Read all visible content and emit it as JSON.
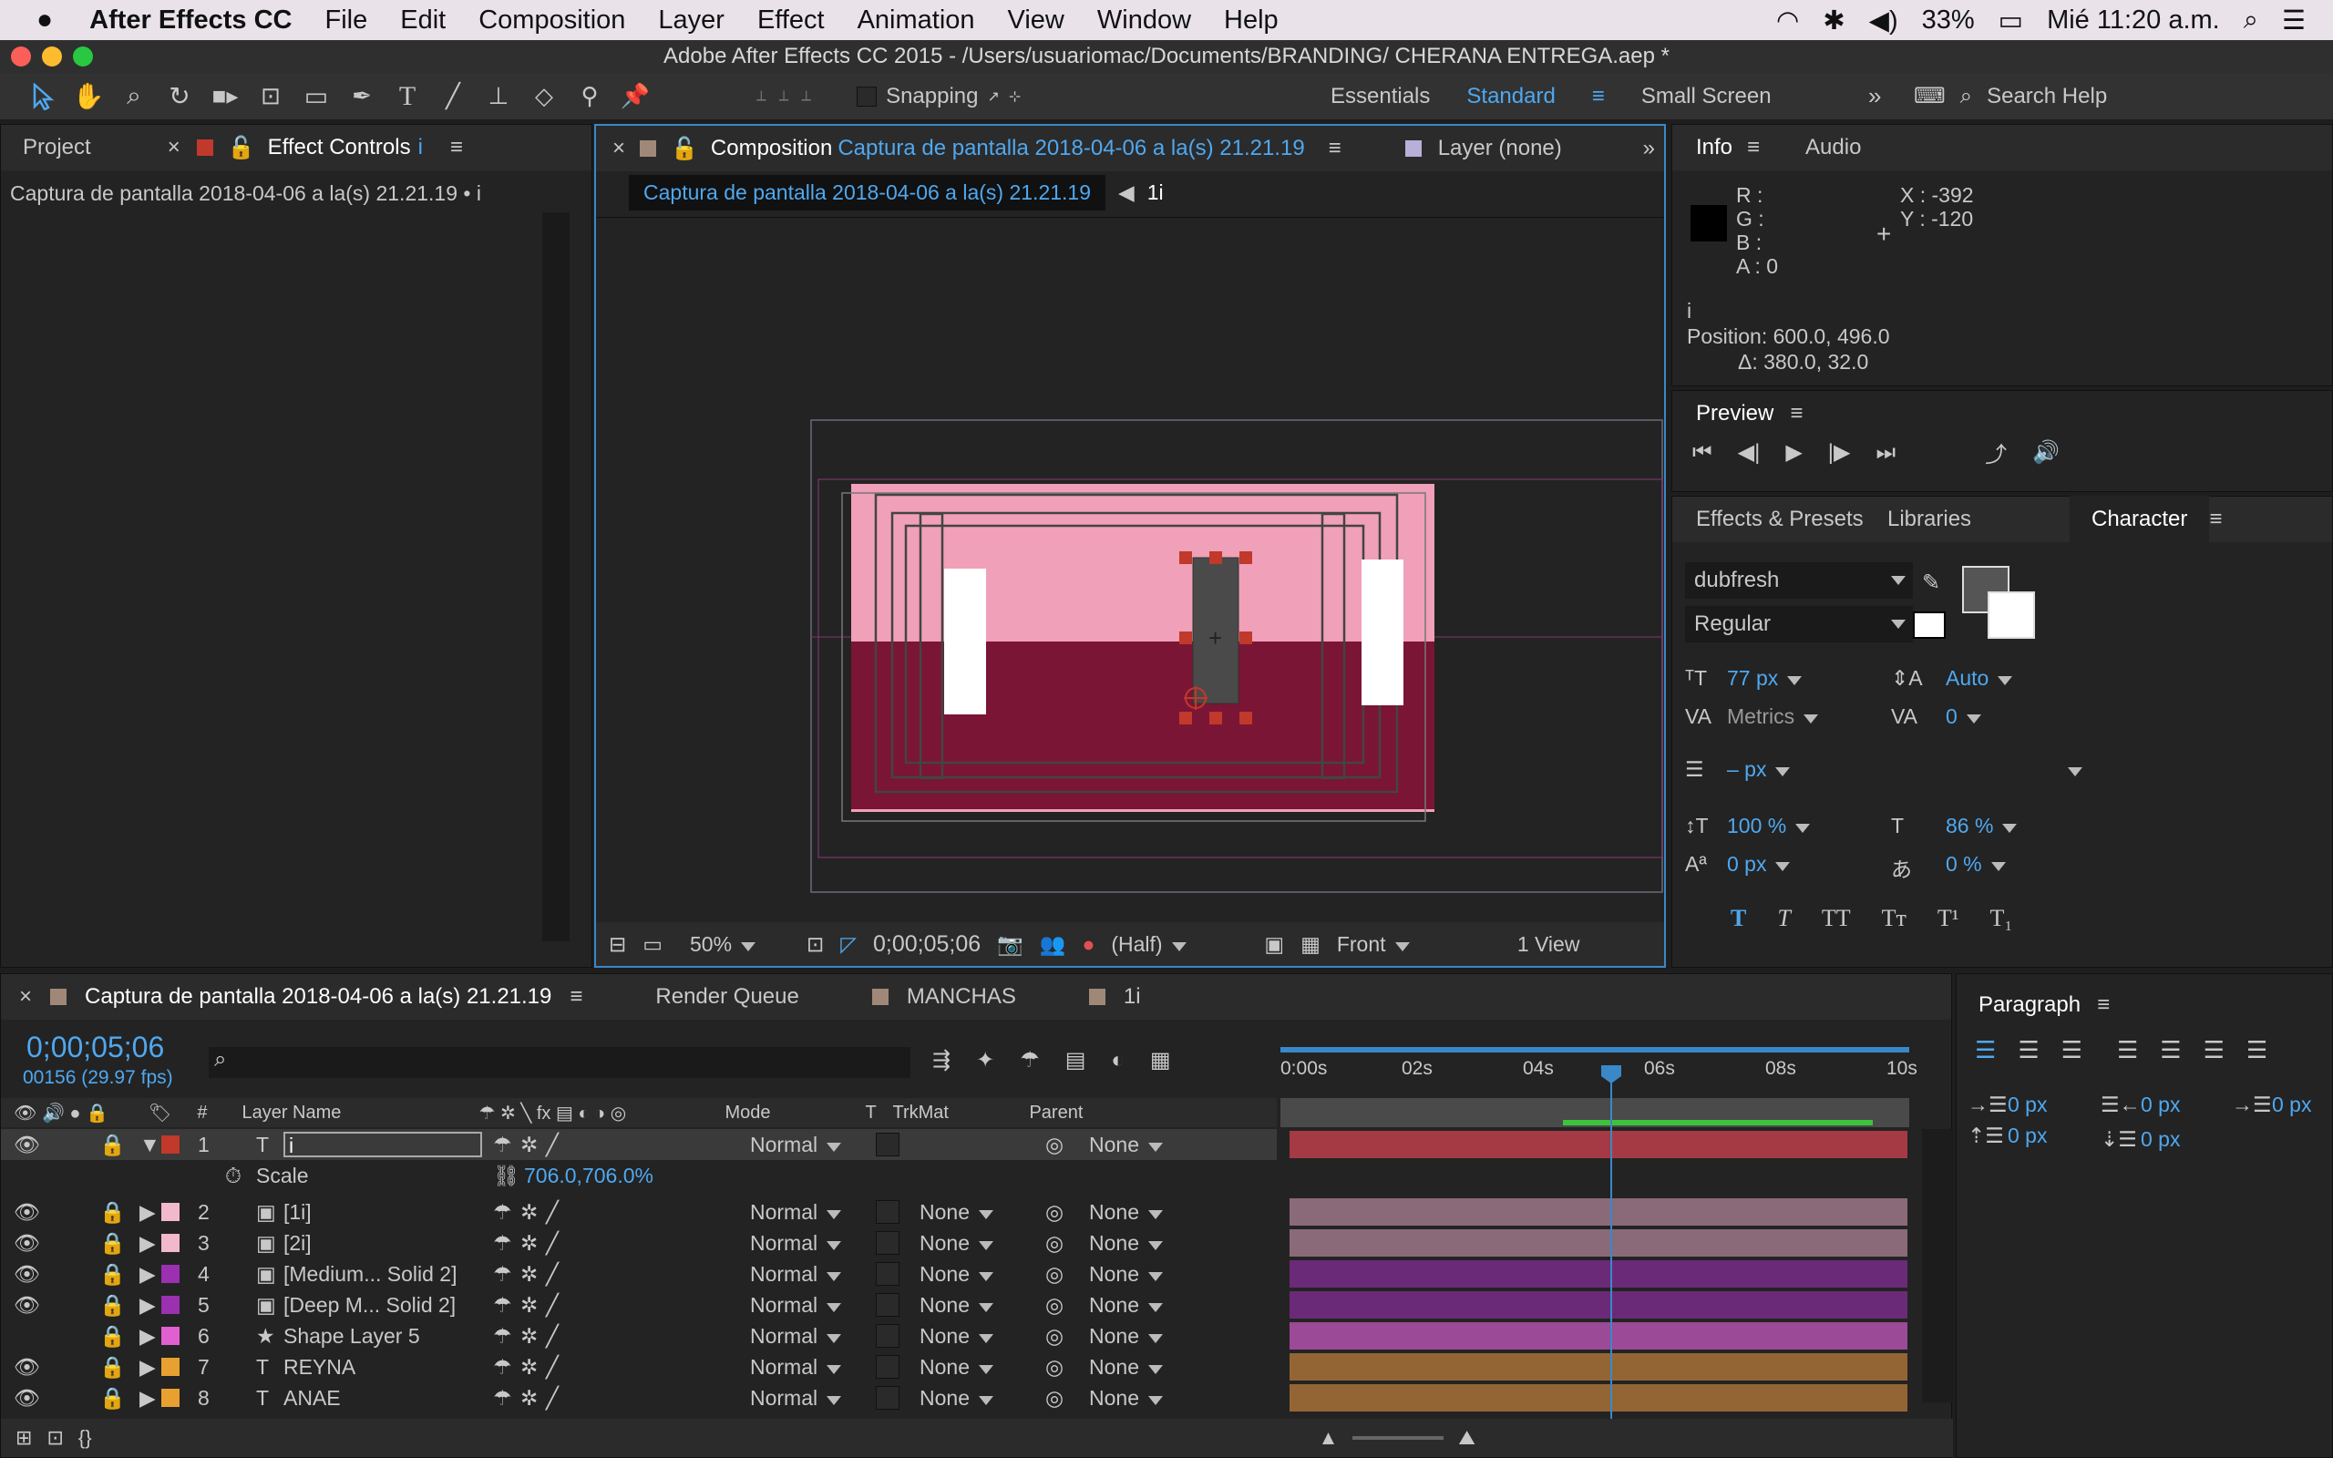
{
  "menubar": {
    "app": "After Effects CC",
    "items": [
      "File",
      "Edit",
      "Composition",
      "Layer",
      "Effect",
      "Animation",
      "View",
      "Window",
      "Help"
    ],
    "battery": "33%",
    "clock": "Mié 11:20 a.m."
  },
  "window_title": "Adobe After Effects CC 2015 - /Users/usuariomac/Documents/BRANDING/ CHERANA ENTREGA.aep *",
  "toolbar": {
    "snapping": "Snapping",
    "workspaces": [
      "Essentials",
      "Standard",
      "Small Screen"
    ],
    "active_workspace": "Standard",
    "search_placeholder": "Search Help"
  },
  "project_panel": {
    "tab_project": "Project",
    "tab_effect_controls": "Effect Controls",
    "tab_effect_layer": "i",
    "breadcrumb": "Captura de pantalla 2018-04-06 a la(s) 21.21.19 • i"
  },
  "comp_panel": {
    "tab_prefix": "Composition",
    "tab_name": "Captura de pantalla 2018-04-06 a la(s) 21.21.19",
    "layer_tab": "Layer (none)",
    "crumb_active": "Captura de pantalla 2018-04-06 a la(s) 21.21.19",
    "crumb_next": "1i",
    "zoom": "50%",
    "timecode": "0;00;05;06",
    "resolution": "(Half)",
    "view": "Front",
    "views": "1 View",
    "colors": {
      "pink": "#f0a0b8",
      "maroon": "#7a1535",
      "handle": "#c0392b"
    }
  },
  "info": {
    "tab_info": "Info",
    "tab_audio": "Audio",
    "r": "R :",
    "g": "G :",
    "b": "B :",
    "a": "A : 0",
    "x": "X : -392",
    "y": "Y : -120",
    "layer": "i",
    "position": "Position: 600.0, 496.0",
    "delta": "Δ: 380.0, 32.0"
  },
  "preview": {
    "title": "Preview"
  },
  "character": {
    "tab_effects": "Effects & Presets",
    "tab_libraries": "Libraries",
    "tab_character": "Character",
    "font": "dubfresh",
    "style": "Regular",
    "size": "77 px",
    "leading": "Auto",
    "kerning": "Metrics",
    "tracking": "0",
    "stroke": "– px",
    "vscale": "100 %",
    "hscale": "86 %",
    "baseline": "0 px",
    "tsume": "0 %"
  },
  "timeline": {
    "tab_comp": "Captura de pantalla 2018-04-06 a la(s) 21.21.19",
    "tab_render": "Render Queue",
    "tab_manchas": "MANCHAS",
    "tab_1i": "1i",
    "timecode": "0;00;05;06",
    "frames": "00156 (29.97 fps)",
    "ruler": [
      "0:00s",
      "02s",
      "04s",
      "06s",
      "08s",
      "10s"
    ],
    "headers": {
      "num": "#",
      "name": "Layer Name",
      "mode": "Mode",
      "t": "T",
      "trkmat": "TrkMat",
      "parent": "Parent"
    },
    "scale_label": "Scale",
    "scale_value": "706.0,706.0%",
    "layers": [
      {
        "num": "1",
        "name": "i",
        "color": "#c0392b",
        "mode": "Normal",
        "trk": "",
        "parent": "None",
        "bar": "#a53a45"
      },
      {
        "num": "2",
        "name": "[1i]",
        "color": "#f2b8cc",
        "mode": "Normal",
        "trk": "None",
        "parent": "None",
        "bar": "#8a6a78"
      },
      {
        "num": "3",
        "name": "[2i]",
        "color": "#f2b8cc",
        "mode": "Normal",
        "trk": "None",
        "parent": "None",
        "bar": "#8a6a78"
      },
      {
        "num": "4",
        "name": "[Medium... Solid 2]",
        "color": "#9b30b0",
        "mode": "Normal",
        "trk": "None",
        "parent": "None",
        "bar": "#6b2a78"
      },
      {
        "num": "5",
        "name": "[Deep M... Solid 2]",
        "color": "#9b30b0",
        "mode": "Normal",
        "trk": "None",
        "parent": "None",
        "bar": "#6b2a78"
      },
      {
        "num": "6",
        "name": "Shape Layer 5",
        "color": "#e060d0",
        "mode": "Normal",
        "trk": "None",
        "parent": "None",
        "bar": "#9a4a96"
      },
      {
        "num": "7",
        "name": "REYNA",
        "color": "#e8a030",
        "mode": "Normal",
        "trk": "None",
        "parent": "None",
        "bar": "#936535"
      },
      {
        "num": "8",
        "name": "ANAE",
        "color": "#e8a030",
        "mode": "Normal",
        "trk": "None",
        "parent": "None",
        "bar": "#936535"
      }
    ]
  },
  "paragraph": {
    "title": "Paragraph",
    "indent_left": "0 px",
    "indent_right": "0 px",
    "indent_first": "0 px",
    "space_before": "0 px",
    "space_after": "0 px"
  }
}
